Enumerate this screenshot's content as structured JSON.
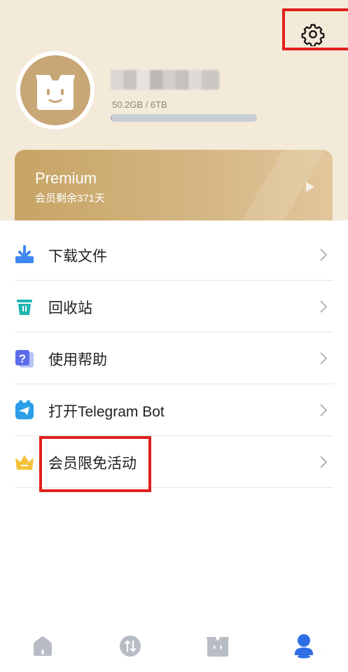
{
  "header": {
    "storage_text": "50.2GB / 6TB",
    "storage_used_fraction": 0.0082
  },
  "premium": {
    "title": "Premium",
    "subtitle": "会员剩余371天",
    "accent": "#c7a465"
  },
  "menu": {
    "items": [
      {
        "label": "下载文件",
        "icon": "download-icon"
      },
      {
        "label": "回收站",
        "icon": "trash-icon"
      },
      {
        "label": "使用帮助",
        "icon": "help-icon"
      },
      {
        "label": "打开Telegram Bot",
        "icon": "telegram-icon"
      },
      {
        "label": "会员限免活动",
        "icon": "crown-icon"
      }
    ]
  },
  "bottom_nav": {
    "items": [
      {
        "icon": "home-icon"
      },
      {
        "icon": "transfer-icon"
      },
      {
        "icon": "box-icon"
      },
      {
        "icon": "profile-icon",
        "active": true
      }
    ],
    "active_color": "#2f6fe4",
    "inactive_color": "#b8bcc4"
  },
  "corner_mark": "·"
}
